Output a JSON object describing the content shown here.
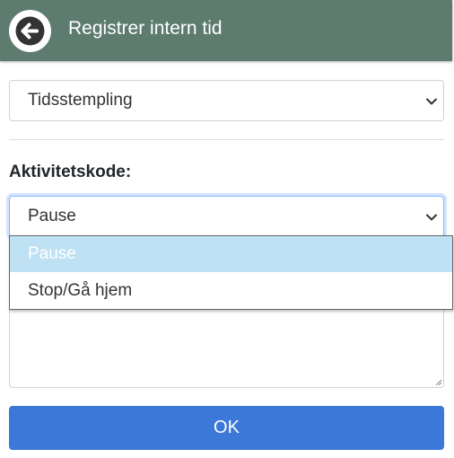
{
  "header": {
    "title": "Registrer intern tid",
    "back_icon": "arrow-left-icon",
    "background_color": "#5e7b6f"
  },
  "mode_select": {
    "value": "Tidsstempling"
  },
  "activity": {
    "label": "Aktivitetskode:",
    "value": "Pause",
    "options": [
      {
        "label": "Pause",
        "selected": true
      },
      {
        "label": "Stop/Gå hjem",
        "selected": false
      }
    ],
    "highlight_color": "#bee1f4"
  },
  "ok_button": {
    "label": "OK",
    "color": "#3c78d8"
  }
}
